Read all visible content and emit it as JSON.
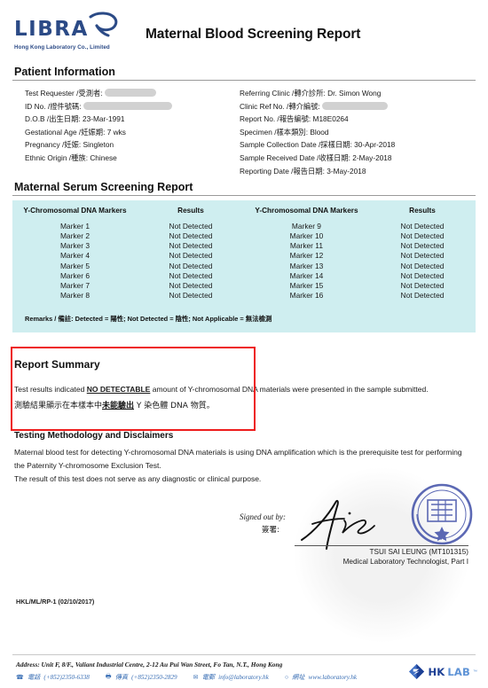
{
  "brand": {
    "logo_text": "LIBRA",
    "logo_subtitle": "Hong Kong Laboratory Co., Limited",
    "footer_logo_hk": "HK",
    "footer_logo_lab": "LAB",
    "footer_logo_tm": "™",
    "primary_color": "#2b4a86",
    "accent_color": "#5e93d6",
    "table_bg_color": "#cfeef0",
    "alert_box_color": "#ee1c1c"
  },
  "document": {
    "title": "Maternal Blood Screening Report",
    "form_code": "HKL/ML/RP-1 (02/10/2017)"
  },
  "patient_information": {
    "heading": "Patient Information",
    "left": [
      {
        "label": "Test Requester /受測者:",
        "value": "",
        "redacted": true
      },
      {
        "label": "ID No. /證件號碼:",
        "value": "",
        "redacted": true
      },
      {
        "label": "D.O.B /出生日期:",
        "value": "23-Mar-1991",
        "redacted": false
      },
      {
        "label": "Gestational Age /妊娠期:",
        "value": "7 wks",
        "redacted": false
      },
      {
        "label": "Pregnancy /妊娠:",
        "value": "Singleton",
        "redacted": false
      },
      {
        "label": "Ethnic Origin /種族:",
        "value": "Chinese",
        "redacted": false
      }
    ],
    "right": [
      {
        "label": "Referring Clinic /轉介診所:",
        "value": "Dr. Simon Wong",
        "redacted": false
      },
      {
        "label": "Clinic Ref No. /轉介編號:",
        "value": "",
        "redacted": true
      },
      {
        "label": "Report No. /報告編號:",
        "value": "M18E0264",
        "redacted": false
      },
      {
        "label": "Specimen /樣本類別:",
        "value": "Blood",
        "redacted": false
      },
      {
        "label": "Sample Collection Date /採樣日期:",
        "value": "30-Apr-2018",
        "redacted": false
      },
      {
        "label": "Sample Received Date /收樣日期:",
        "value": "2-May-2018",
        "redacted": false
      },
      {
        "label": "Reporting Date /報告日期:",
        "value": "3-May-2018",
        "redacted": false
      }
    ]
  },
  "serum_report": {
    "heading": "Maternal Serum Screening Report",
    "columns": [
      "Y-Chromosomal DNA Markers",
      "Results",
      "Y-Chromosomal DNA Markers",
      "Results"
    ],
    "rows": [
      [
        "Marker 1",
        "Not Detected",
        "Marker 9",
        "Not Detected"
      ],
      [
        "Marker 2",
        "Not Detected",
        "Marker 10",
        "Not Detected"
      ],
      [
        "Marker 3",
        "Not Detected",
        "Marker 11",
        "Not Detected"
      ],
      [
        "Marker 4",
        "Not Detected",
        "Marker 12",
        "Not Detected"
      ],
      [
        "Marker 5",
        "Not Detected",
        "Marker 13",
        "Not Detected"
      ],
      [
        "Marker 6",
        "Not Detected",
        "Marker 14",
        "Not Detected"
      ],
      [
        "Marker 7",
        "Not Detected",
        "Marker 15",
        "Not Detected"
      ],
      [
        "Marker 8",
        "Not Detected",
        "Marker 16",
        "Not Detected"
      ]
    ],
    "remarks": "Remarks / 備註: Detected = 陽性; Not Detected = 陰性; Not Applicable = 無法檢測"
  },
  "report_summary": {
    "heading": "Report Summary",
    "english_prefix": "Test results indicated ",
    "english_emphasis": "NO DETECTABLE",
    "english_suffix": " amount of Y-chromosomal DNA materials were presented in the sample submitted.",
    "chinese_prefix": "測驗結果顯示在本樣本中",
    "chinese_emphasis": "未能驗出",
    "chinese_suffix": " Y 染色體 DNA 物質。"
  },
  "methodology": {
    "heading": "Testing Methodology and Disclaimers",
    "paragraph1": "Maternal blood test for detecting Y-chromosomal DNA materials is using DNA amplification which is the prerequisite test for performing the Paternity Y-chromosome Exclusion Test.",
    "paragraph2": "The result of this test does not serve as any diagnostic or clinical purpose."
  },
  "signature": {
    "signed_out_by": "Signed out by:",
    "signed_out_by_zh": "簽署:",
    "name": "TSUI SAI LEUNG (MT101315)",
    "role": "Medical Laboratory Technologist, Part I"
  },
  "footer": {
    "address": "Address: Unit F, 8/F., Valiant Industrial Centre, 2-12 Au Pui Wan Street, Fo Tan, N.T., Hong Kong",
    "phone_label": "電話",
    "phone": "(+852)2350-6338",
    "fax_label": "傳真",
    "fax": "(+852)2350-2829",
    "email_label": "電郵",
    "email": "info@laboratory.hk",
    "web_label": "網址",
    "website": "www.laboratory.hk"
  }
}
